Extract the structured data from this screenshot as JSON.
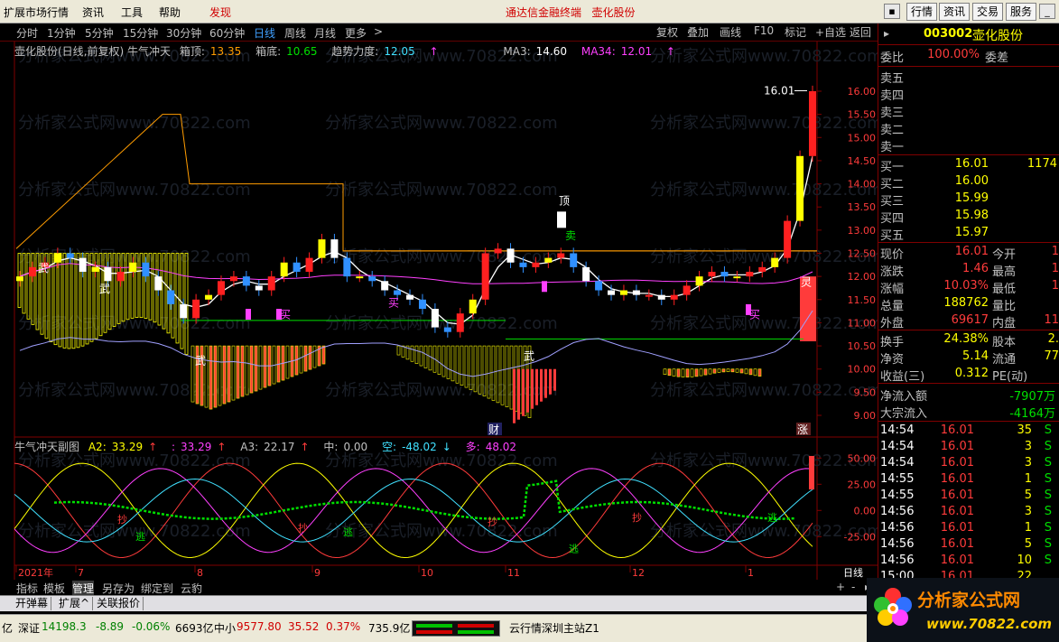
{
  "menu": {
    "items": [
      "扩展市场行情",
      "资讯",
      "工具",
      "帮助"
    ],
    "discover": "发现",
    "center_title": "通达信金融终端",
    "center_stock": "壶化股份",
    "right_buttons": [
      "行情",
      "资讯",
      "交易",
      "服务"
    ]
  },
  "periods": {
    "tabs": [
      "分时",
      "1分钟",
      "5分钟",
      "15分钟",
      "30分钟",
      "60分钟",
      "日线",
      "周线",
      "月线",
      "更多"
    ],
    "active": "日线",
    "more_arrow": ">",
    "toolbar": [
      "复权",
      "叠加",
      "画线",
      "F10",
      "标记",
      "+自选",
      "返回"
    ]
  },
  "chart_header": {
    "title": "壶化股份(日线,前复权) 牛气冲天",
    "xd_label": "箱顶:",
    "xd_value": "13.35",
    "xdi_label": "箱底:",
    "xdi_value": "10.65",
    "qs_label": "趋势力度:",
    "qs_value": "12.05",
    "ma3_label": "MA3:",
    "ma3_value": "14.60",
    "ma34_label": "MA34:",
    "ma34_value": "12.01"
  },
  "chart_labels": {
    "peak": "16.01",
    "top": "顶",
    "sell": "卖",
    "buy": "买",
    "wu": "武",
    "cai": "财",
    "zhang": "涨",
    "ling": "灵"
  },
  "sub_header": {
    "title": "牛气冲天副图",
    "a2_label": "A2:",
    "a2_value": "33.29",
    "a2b_value": "33.29",
    "a3_label": "A3:",
    "a3_value": "22.17",
    "zhong_label": "中:",
    "zhong_value": "0.00",
    "kong_label": "空:",
    "kong_value": "-48.02",
    "duo_label": "多:",
    "duo_value": "48.02"
  },
  "sub_labels": {
    "chao": "抄",
    "tao": "逃"
  },
  "watermark": "分析家公式网www.70822.com",
  "chart_data": [
    {
      "type": "candlestick",
      "yticks": [
        "16.00",
        "15.50",
        "15.00",
        "14.50",
        "14.00",
        "13.50",
        "13.00",
        "12.50",
        "12.00",
        "11.50",
        "11.00",
        "10.50",
        "10.00",
        "9.50",
        "9.00"
      ],
      "ylim": [
        9.0,
        16.0
      ],
      "box_top": 13.35,
      "box_bottom": 10.65,
      "peak": 16.01,
      "close": [
        12.0,
        12.2,
        12.3,
        12.5,
        12.4,
        12.1,
        12.2,
        11.9,
        12.1,
        12.3,
        12.0,
        11.7,
        11.4,
        11.1,
        11.5,
        11.6,
        11.9,
        12.0,
        11.8,
        11.7,
        12.0,
        12.3,
        12.1,
        12.4,
        12.8,
        12.4,
        12.0,
        12.0,
        11.9,
        11.7,
        11.6,
        11.5,
        11.3,
        10.9,
        10.8,
        11.2,
        11.5,
        12.5,
        12.6,
        12.3,
        12.2,
        12.3,
        12.4,
        12.5,
        12.2,
        11.9,
        11.7,
        11.6,
        11.7,
        11.6,
        11.6,
        11.5,
        11.6,
        11.8,
        12.0,
        12.1,
        12.0,
        12.0,
        12.1,
        12.2,
        12.4,
        13.2,
        14.6,
        16.0
      ],
      "open": [
        11.9,
        12.0,
        12.2,
        12.3,
        12.5,
        12.4,
        12.1,
        12.2,
        11.9,
        12.1,
        12.3,
        12.0,
        11.7,
        11.4,
        11.1,
        11.5,
        11.6,
        11.9,
        12.0,
        11.8,
        11.7,
        12.0,
        12.3,
        12.1,
        12.4,
        12.8,
        12.4,
        12.0,
        12.0,
        11.9,
        11.7,
        11.6,
        11.5,
        11.3,
        10.9,
        10.8,
        11.2,
        11.5,
        12.5,
        12.6,
        12.3,
        12.2,
        12.3,
        12.4,
        12.5,
        12.2,
        11.9,
        11.7,
        11.6,
        11.7,
        11.6,
        11.6,
        11.5,
        11.6,
        11.8,
        12.0,
        12.1,
        12.0,
        12.0,
        12.1,
        12.2,
        12.4,
        13.2,
        14.6
      ]
    },
    {
      "type": "line",
      "yticks": [
        "50.00",
        "25.00",
        "0.00",
        "-25.00"
      ],
      "ylim": [
        -48,
        58
      ]
    }
  ],
  "xaxis": {
    "labels": [
      "2021年",
      "7",
      "8",
      "9",
      "10",
      "11",
      "12",
      "1"
    ],
    "period": "日线"
  },
  "right_panel": {
    "code": "003002",
    "name": "壶化股份",
    "wb_label": "委比",
    "wb_value": "100.00%",
    "wc_label": "委差",
    "sell": [
      "卖五",
      "卖四",
      "卖三",
      "卖二",
      "卖一"
    ],
    "buy": [
      {
        "label": "买一",
        "price": "16.01",
        "vol": "1174"
      },
      {
        "label": "买二",
        "price": "16.00",
        "vol": ""
      },
      {
        "label": "买三",
        "price": "15.99",
        "vol": ""
      },
      {
        "label": "买四",
        "price": "15.98",
        "vol": ""
      },
      {
        "label": "买五",
        "price": "15.97",
        "vol": ""
      }
    ],
    "stats": [
      {
        "l1": "现价",
        "v1": "16.01",
        "c1": "#ff3b3b",
        "l2": "今开",
        "v2": "1"
      },
      {
        "l1": "涨跌",
        "v1": "1.46",
        "c1": "#ff3b3b",
        "l2": "最高",
        "v2": "1"
      },
      {
        "l1": "涨幅",
        "v1": "10.03%",
        "c1": "#ff3b3b",
        "l2": "最低",
        "v2": "1"
      },
      {
        "l1": "总量",
        "v1": "188762",
        "c1": "#ffff00",
        "l2": "量比",
        "v2": ""
      },
      {
        "l1": "外盘",
        "v1": "69617",
        "c1": "#ff3b3b",
        "l2": "内盘",
        "v2": "11"
      }
    ],
    "stats2": [
      {
        "l1": "换手",
        "v1": "24.38%",
        "l2": "股本",
        "v2": "2."
      },
      {
        "l1": "净资",
        "v1": "5.14",
        "l2": "流通",
        "v2": "77"
      },
      {
        "l1": "收益(三)",
        "v1": "0.312",
        "l2": "PE(动)",
        "v2": ""
      }
    ],
    "flow": [
      {
        "label": "净流入额",
        "value": "-7907万"
      },
      {
        "label": "大宗流入",
        "value": "-4164万"
      }
    ],
    "ticks": [
      {
        "t": "14:54",
        "p": "16.01",
        "v": "35",
        "s": "S"
      },
      {
        "t": "14:54",
        "p": "16.01",
        "v": "3",
        "s": "S"
      },
      {
        "t": "14:54",
        "p": "16.01",
        "v": "3",
        "s": "S"
      },
      {
        "t": "14:55",
        "p": "16.01",
        "v": "1",
        "s": "S"
      },
      {
        "t": "14:55",
        "p": "16.01",
        "v": "5",
        "s": "S"
      },
      {
        "t": "14:56",
        "p": "16.01",
        "v": "3",
        "s": "S"
      },
      {
        "t": "14:56",
        "p": "16.01",
        "v": "1",
        "s": "S"
      },
      {
        "t": "14:56",
        "p": "16.01",
        "v": "5",
        "s": "S"
      },
      {
        "t": "14:56",
        "p": "16.01",
        "v": "10",
        "s": "S"
      },
      {
        "t": "15:00",
        "p": "16.01",
        "v": "22",
        "s": ""
      }
    ]
  },
  "bottom_tabs1": [
    "指标",
    "模板",
    "管理",
    "另存为",
    "绑定到",
    "云豹"
  ],
  "bottom_tabs1_active": "管理",
  "bottom_tabs2": [
    "开弹幕",
    "扩展^",
    "关联报价"
  ],
  "status": {
    "yi": "亿",
    "sz_label": "深证",
    "sz_value": "14198.3",
    "sz_chg": "-8.89",
    "sz_pct": "-0.06%",
    "sz_amt": "6693亿",
    "zx_label": "中小",
    "zx_value": "9577.80",
    "zx_chg": "35.52",
    "zx_pct": "0.37%",
    "zx_amt": "735.9亿",
    "server": "云行情深圳主站Z1"
  },
  "logo": {
    "brand": "分析家公式网",
    "url": "www.70822.com"
  },
  "colors": {
    "red": "#ff3b3b",
    "green": "#00e000",
    "yellow": "#ffff00",
    "orange": "#ff9c00",
    "magenta": "#ff40ff",
    "cyan": "#40e0ff",
    "up": "#ff2020",
    "down": "#3090ff"
  }
}
